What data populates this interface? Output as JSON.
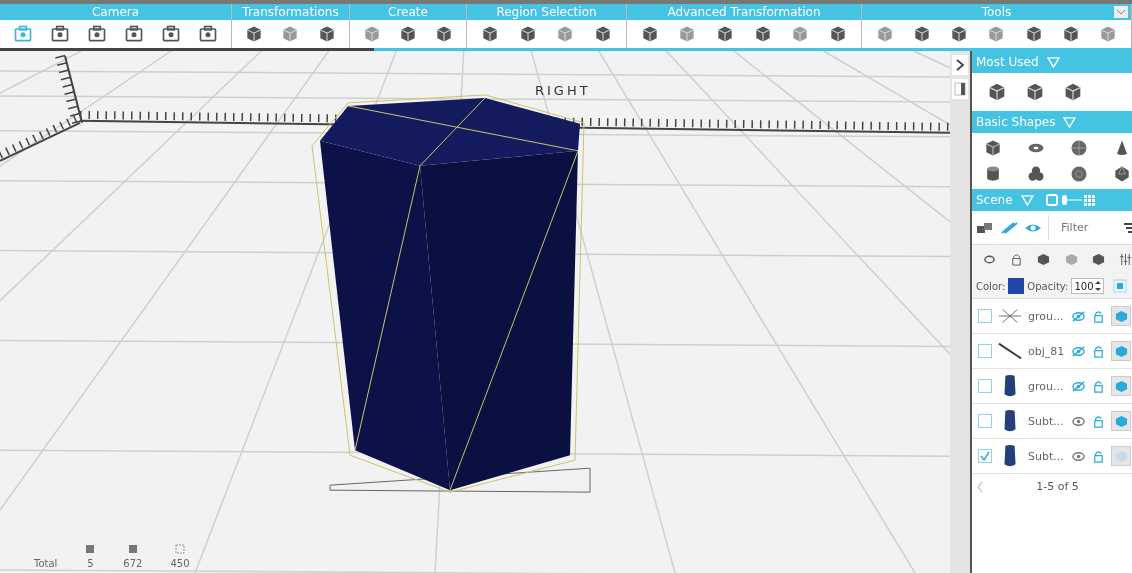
{
  "toolbar": {
    "groups": [
      {
        "title": "Camera"
      },
      {
        "title": "Transformations"
      },
      {
        "title": "Create"
      },
      {
        "title": "Region Selection"
      },
      {
        "title": "Advanced Transformation"
      },
      {
        "title": "Tools"
      }
    ]
  },
  "viewport": {
    "axis_label": "RIGHT",
    "stats": [
      {
        "label": "Total"
      },
      {
        "value": "5"
      },
      {
        "value": "672"
      },
      {
        "value": "450"
      }
    ]
  },
  "panel": {
    "most_used": {
      "title": "Most Used"
    },
    "basic_shapes": {
      "title": "Basic Shapes"
    },
    "scene": {
      "title": "Scene",
      "filter": {
        "placeholder": "Filter"
      },
      "color": {
        "label": "Color:",
        "color": "#2148a8"
      },
      "opacity": {
        "label": "Opacity:",
        "value": "100"
      },
      "objects": [
        {
          "name": "grou...",
          "checked": false,
          "kind": "rays",
          "hidden": true,
          "material_enabled": true
        },
        {
          "name": "obj_81",
          "checked": false,
          "kind": "line",
          "hidden": true,
          "material_enabled": true
        },
        {
          "name": "grou...",
          "checked": false,
          "kind": "cylinder",
          "hidden": true,
          "material_enabled": true
        },
        {
          "name": "Subt...",
          "checked": false,
          "kind": "cylinder",
          "hidden": false,
          "material_enabled": true
        },
        {
          "name": "Subt...",
          "checked": true,
          "kind": "cylinder",
          "hidden": false,
          "material_enabled": false
        }
      ],
      "pager": "1-5 of 5"
    }
  }
}
